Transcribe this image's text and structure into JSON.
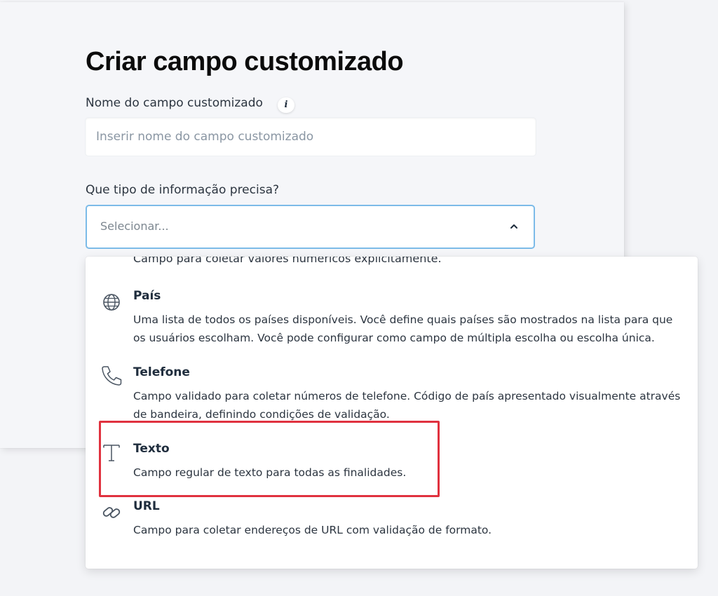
{
  "form": {
    "title": "Criar campo customizado",
    "name_label": "Nome do campo customizado",
    "info_icon_glyph": "i",
    "name_input_placeholder": "Inserir nome do campo customizado",
    "name_input_value": "",
    "type_label": "Que tipo de informação precisa?",
    "select_placeholder": "Selecionar..."
  },
  "dropdown": {
    "partial_option_desc": "Campo para coletar valores numéricos explicitamente.",
    "options": [
      {
        "title": "País",
        "icon": "globe-icon",
        "desc": "Uma lista de todos os países disponíveis. Você define quais países são mostrados na lista para que os usuários escolham. Você pode configurar como campo de múltipla escolha ou escolha única."
      },
      {
        "title": "Telefone",
        "icon": "phone-icon",
        "desc": "Campo validado para coletar números de telefone. Código de país apresentado visualmente através de bandeira, definindo condições de validação."
      },
      {
        "title": "Texto",
        "icon": "text-icon",
        "desc": "Campo regular de texto para todas as finalidades."
      },
      {
        "title": "URL",
        "icon": "link-icon",
        "desc": "Campo para coletar endereços de URL com validação de formato."
      }
    ]
  },
  "colors": {
    "highlight_border": "#e0323f",
    "select_focus_border": "#7cbbe8"
  }
}
